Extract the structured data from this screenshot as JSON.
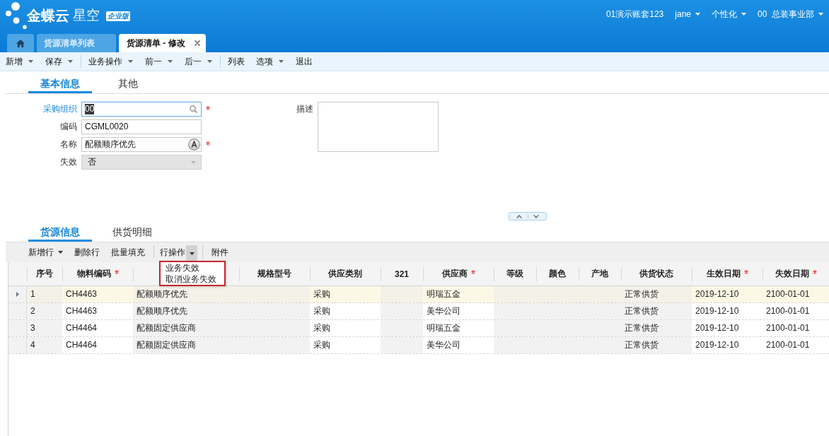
{
  "header": {
    "logo": {
      "brand": "金蝶云",
      "product": "星空",
      "edition": "企业版"
    },
    "user_menu": [
      {
        "label": "01演示账套123",
        "dropdown": false
      },
      {
        "label": "jane",
        "dropdown": true
      },
      {
        "label": "个性化",
        "dropdown": true
      },
      {
        "label": "00  总装事业部",
        "dropdown": true
      }
    ]
  },
  "doc_tabs": [
    {
      "kind": "home",
      "selected": false
    },
    {
      "kind": "page",
      "label": "货源清单列表",
      "selected": false,
      "closable": false
    },
    {
      "kind": "page",
      "label": "货源清单 - 修改",
      "selected": true,
      "closable": true
    }
  ],
  "toolbar": [
    {
      "kind": "button",
      "label": "新增",
      "dropdown": true
    },
    {
      "kind": "button",
      "label": "保存",
      "dropdown": true
    },
    {
      "kind": "separator"
    },
    {
      "kind": "button",
      "label": "业务操作",
      "dropdown": true
    },
    {
      "kind": "button",
      "label": "前一",
      "dropdown": true
    },
    {
      "kind": "button",
      "label": "后一",
      "dropdown": true
    },
    {
      "kind": "separator"
    },
    {
      "kind": "button",
      "label": "列表",
      "dropdown": false
    },
    {
      "kind": "button",
      "label": "选项",
      "dropdown": true
    },
    {
      "kind": "button",
      "label": "退出",
      "dropdown": false
    }
  ],
  "form_tabs": [
    {
      "label": "基本信息",
      "selected": true
    },
    {
      "label": "其他",
      "selected": false
    }
  ],
  "fields": [
    {
      "kind": "lookup",
      "label": "采购组织",
      "value": "00",
      "required": true,
      "focused": true,
      "link": true,
      "disabled": false
    },
    {
      "kind": "text",
      "label": "编码",
      "value": "CGML0020",
      "required": false,
      "focused": false,
      "link": false,
      "disabled": false
    },
    {
      "kind": "multilang",
      "label": "名称",
      "value": "配额顺序优先",
      "required": true,
      "focused": false,
      "link": false,
      "disabled": false
    },
    {
      "kind": "select",
      "label": "失效",
      "value": "否",
      "required": false,
      "focused": false,
      "link": false,
      "disabled": true
    }
  ],
  "description": {
    "label": "描述"
  },
  "detail_tabs": [
    {
      "label": "货源信息",
      "selected": true
    },
    {
      "label": "供货明细",
      "selected": false
    }
  ],
  "grid_toolbar": [
    {
      "kind": "button",
      "label": "新增行",
      "dropdown": true
    },
    {
      "kind": "button",
      "label": "删除行",
      "dropdown": false
    },
    {
      "kind": "button",
      "label": "批量填充",
      "dropdown": false
    },
    {
      "kind": "separator"
    },
    {
      "kind": "split",
      "label": "行操作",
      "open": true,
      "menu": [
        {
          "label": "业务失效"
        },
        {
          "label": "取消业务失效"
        }
      ]
    },
    {
      "kind": "separator"
    },
    {
      "kind": "button",
      "label": "附件",
      "dropdown": false
    }
  ],
  "table": {
    "columns": [
      {
        "label": "序号",
        "required": false,
        "locked": true
      },
      {
        "label": "物料编码",
        "required": true,
        "locked": false
      },
      {
        "locked": true
      },
      {
        "label": "规格型号",
        "required": false,
        "locked": true
      },
      {
        "label": "供应类别",
        "required": false,
        "locked": false
      },
      {
        "label": "321",
        "required": false,
        "locked": true
      },
      {
        "label": "供应商",
        "required": true,
        "locked": false
      },
      {
        "label": "等级",
        "required": false,
        "locked": true
      },
      {
        "label": "颜色",
        "required": false,
        "locked": true
      },
      {
        "label": "产地",
        "required": false,
        "locked": true
      },
      {
        "label": "供货状态",
        "required": false,
        "locked": true
      },
      {
        "label": "生效日期",
        "required": true,
        "locked": false
      },
      {
        "label": "失效日期",
        "required": true,
        "locked": false
      }
    ],
    "rows": [
      {
        "selected": true,
        "cells": [
          "1",
          "CH4463",
          "配额顺序优先",
          null,
          "采购",
          null,
          "明瑞五金",
          null,
          null,
          null,
          "正常供货",
          "2019-12-10",
          "2100-01-01"
        ]
      },
      {
        "selected": false,
        "cells": [
          "2",
          "CH4463",
          "配额顺序优先",
          null,
          "采购",
          null,
          "美华公司",
          null,
          null,
          null,
          "正常供货",
          "2019-12-10",
          "2100-01-01"
        ]
      },
      {
        "selected": false,
        "cells": [
          "3",
          "CH4464",
          "配额固定供应商",
          null,
          "采购",
          null,
          "明瑞五金",
          null,
          null,
          null,
          "正常供货",
          "2019-12-10",
          "2100-01-01"
        ]
      },
      {
        "selected": false,
        "cells": [
          "4",
          "CH4464",
          "配额固定供应商",
          null,
          "采购",
          null,
          "美华公司",
          null,
          null,
          null,
          "正常供货",
          "2019-12-10",
          "2100-01-01"
        ]
      }
    ]
  }
}
